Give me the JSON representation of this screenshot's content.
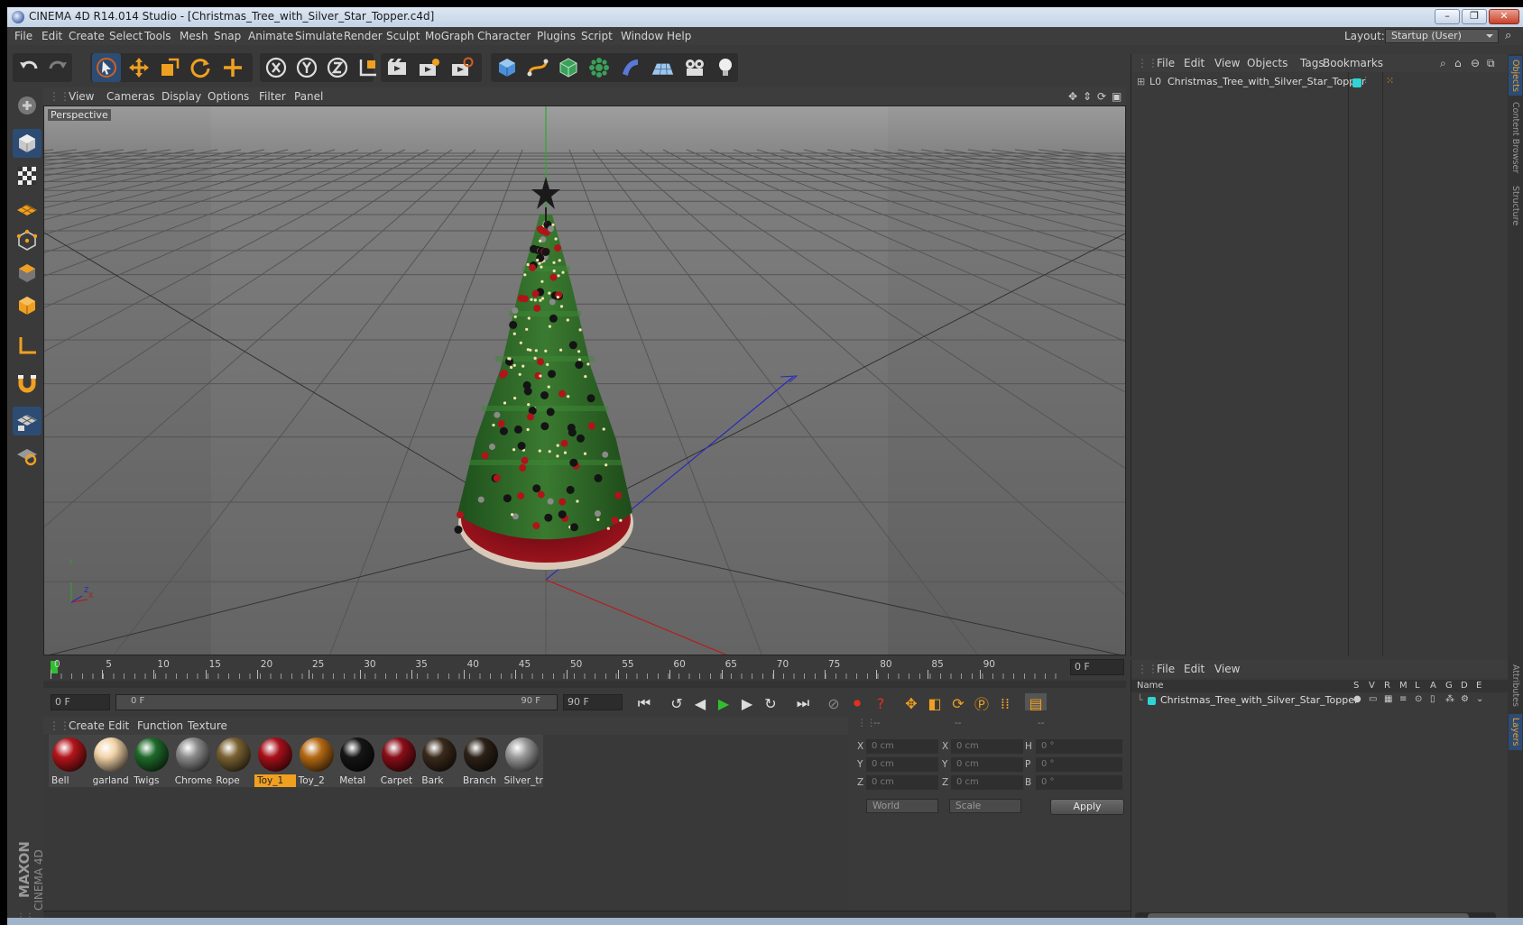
{
  "window": {
    "title": "CINEMA 4D R14.014 Studio - [Christmas_Tree_with_Silver_Star_Topper.c4d]"
  },
  "menu": [
    "File",
    "Edit",
    "Create",
    "Select",
    "Tools",
    "Mesh",
    "Snap",
    "Animate",
    "Simulate",
    "Render",
    "Sculpt",
    "MoGraph",
    "Character",
    "Plugins",
    "Script",
    "Window",
    "Help"
  ],
  "layout": {
    "label": "Layout:",
    "value": "Startup (User)"
  },
  "viewport": {
    "menu": [
      "View",
      "Cameras",
      "Display",
      "Options",
      "Filter",
      "Panel"
    ],
    "label": "Perspective",
    "axis_y": "Y",
    "axis_x": "X",
    "axis_z": "Z"
  },
  "timeline": {
    "ticks": [
      "0",
      "5",
      "10",
      "15",
      "20",
      "25",
      "30",
      "35",
      "40",
      "45",
      "50",
      "55",
      "60",
      "65",
      "70",
      "75",
      "80",
      "85",
      "90"
    ],
    "current_frame": "0 F",
    "start_field": "0 F",
    "range_start": "0 F",
    "range_end": "90 F",
    "end_field": "90 F"
  },
  "materials": {
    "menu": [
      "Create",
      "Edit",
      "Function",
      "Texture"
    ],
    "items": [
      {
        "name": "Bell",
        "color": "#b3151a"
      },
      {
        "name": "garland",
        "color": "#f2d3a8"
      },
      {
        "name": "Twigs",
        "color": "#1f6a2a"
      },
      {
        "name": "Chrome",
        "color": "#8c8c8c"
      },
      {
        "name": "Rope",
        "color": "#7a6232"
      },
      {
        "name": "Toy_1",
        "color": "#a8101a",
        "selected": true
      },
      {
        "name": "Toy_2",
        "color": "#b56a14"
      },
      {
        "name": "Metal",
        "color": "#151515"
      },
      {
        "name": "Carpet",
        "color": "#8a0e18"
      },
      {
        "name": "Bark",
        "color": "#3a2a1c"
      },
      {
        "name": "Branch",
        "color": "#2c2218"
      },
      {
        "name": "Silver_tr",
        "color": "#9a9a9a"
      }
    ]
  },
  "coords": {
    "col_headers": [
      "--",
      "--",
      "--"
    ],
    "pos": [
      {
        "axis": "X",
        "value": "0 cm"
      },
      {
        "axis": "Y",
        "value": "0 cm"
      },
      {
        "axis": "Z",
        "value": "0 cm"
      }
    ],
    "size": [
      {
        "axis": "X",
        "value": "0 cm"
      },
      {
        "axis": "Y",
        "value": "0 cm"
      },
      {
        "axis": "Z",
        "value": "0 cm"
      }
    ],
    "rot": [
      {
        "axis": "H",
        "value": "0 °"
      },
      {
        "axis": "P",
        "value": "0 °"
      },
      {
        "axis": "B",
        "value": "0 °"
      }
    ],
    "mode1": "World",
    "mode2": "Scale",
    "apply": "Apply"
  },
  "objects_panel": {
    "menu": [
      "File",
      "Edit",
      "View",
      "Objects",
      "Tags",
      "Bookmarks"
    ],
    "object_name": "Christmas_Tree_with_Silver_Star_Topper",
    "object_color": "#2fd4d4"
  },
  "layers_panel": {
    "menu": [
      "File",
      "Edit",
      "View"
    ],
    "name_header": "Name",
    "flags": [
      "S",
      "V",
      "R",
      "M",
      "L",
      "A",
      "G",
      "D",
      "E"
    ],
    "layer_name": "Christmas_Tree_with_Silver_Star_Topper"
  },
  "side_tabs": [
    "Objects",
    "Content Browser",
    "Structure",
    "Attributes",
    "Layers"
  ],
  "branding": {
    "maxon": "MAXON",
    "product": "CINEMA 4D"
  },
  "colors": {
    "accent": "#f0a020",
    "selection": "#2d4c74",
    "tree_green": "#2e6b2a",
    "skirt_red": "#8a1018"
  }
}
